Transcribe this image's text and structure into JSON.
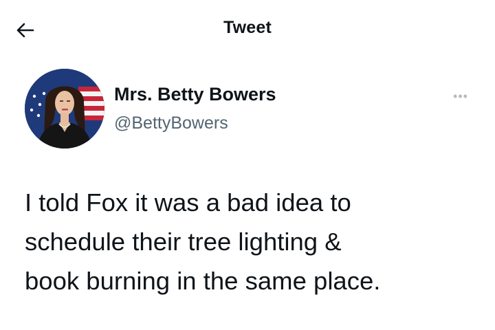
{
  "header": {
    "title": "Tweet",
    "back_icon": "arrow-left-icon"
  },
  "author": {
    "name": "Mrs. Betty Bowers",
    "handle": "@BettyBowers",
    "avatar_icon": "avatar"
  },
  "more_icon": "more-options-icon",
  "tweet": {
    "lines": [
      "I told Fox it was a bad idea to",
      "schedule their tree lighting &",
      "book burning in the same place."
    ]
  },
  "colors": {
    "text": "#0f1419",
    "secondary": "#536471",
    "icon_muted": "#b5bcc2"
  }
}
